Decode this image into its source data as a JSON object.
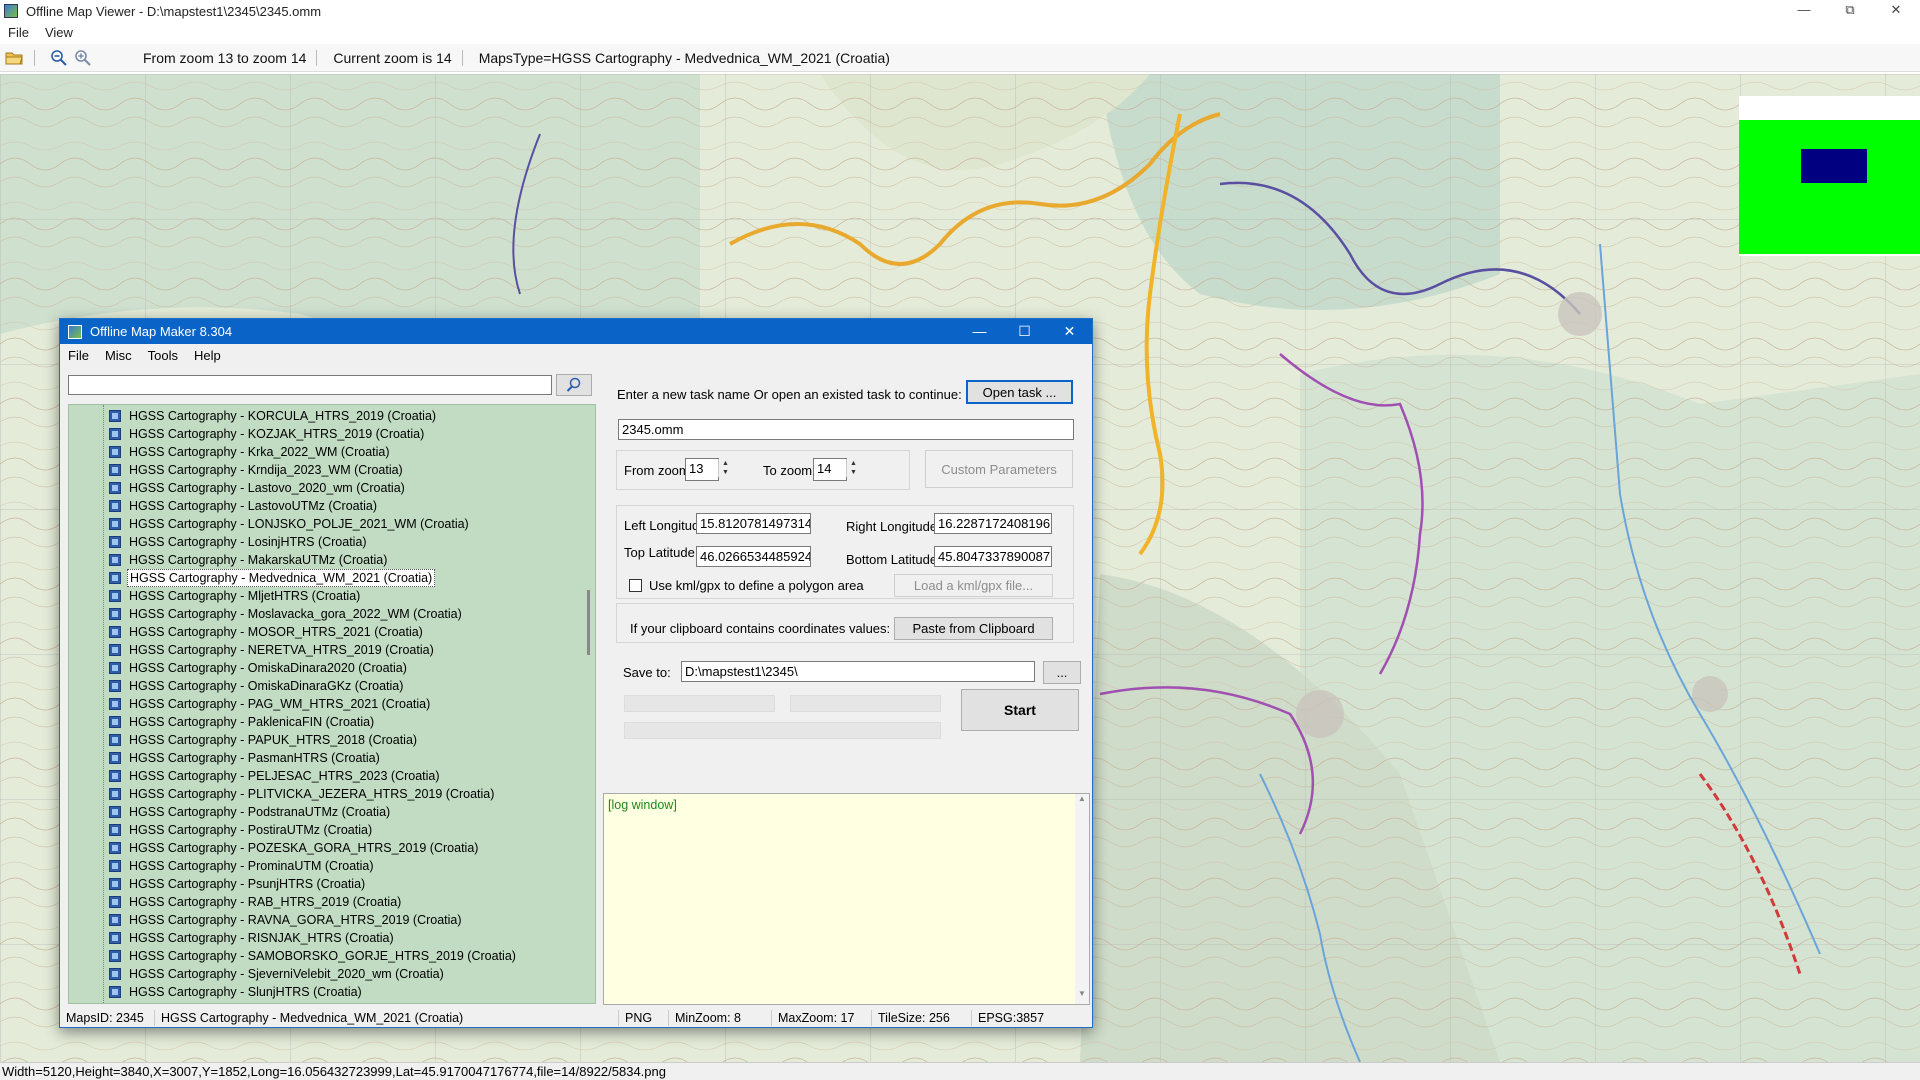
{
  "window": {
    "title": "Offline Map Viewer - D:\\mapstest1\\2345\\2345.omm",
    "menu": [
      "File",
      "View"
    ]
  },
  "toolbar": {
    "icons": [
      "open-folder-icon",
      "zoom-out-icon",
      "zoom-in-icon"
    ],
    "zoom_range": "From zoom 13 to zoom 14",
    "current_zoom": "Current zoom is 14",
    "maps_type": "MapsType=HGSS Cartography - Medvednica_WM_2021 (Croatia)"
  },
  "map": {
    "overview_colors": {
      "frame": "#00ff00",
      "viewport": "#000080"
    }
  },
  "statusbar": {
    "text": "Width=5120,Height=3840,X=3007,Y=1852,Long=16.056432723999,Lat=45.9170047176774,file=14/8922/5834.png"
  },
  "dialog": {
    "title": "Offline Map Maker 8.304",
    "menu": [
      "File",
      "Misc",
      "Tools",
      "Help"
    ],
    "search_value": "",
    "map_list": [
      "HGSS Cartography - KORCULA_HTRS_2019 (Croatia)",
      "HGSS Cartography - KOZJAK_HTRS_2019 (Croatia)",
      "HGSS Cartography - Krka_2022_WM (Croatia)",
      "HGSS Cartography - Krndija_2023_WM (Croatia)",
      "HGSS Cartography - Lastovo_2020_wm (Croatia)",
      "HGSS Cartography - LastovoUTMz (Croatia)",
      "HGSS Cartography - LONJSKO_POLJE_2021_WM (Croatia)",
      "HGSS Cartography - LosinjHTRS (Croatia)",
      "HGSS Cartography - MakarskaUTMz (Croatia)",
      "HGSS Cartography - Medvednica_WM_2021 (Croatia)",
      "HGSS Cartography - MljetHTRS (Croatia)",
      "HGSS Cartography - Moslavacka_gora_2022_WM (Croatia)",
      "HGSS Cartography - MOSOR_HTRS_2021 (Croatia)",
      "HGSS Cartography - NERETVA_HTRS_2019 (Croatia)",
      "HGSS Cartography - OmiskaDinara2020 (Croatia)",
      "HGSS Cartography - OmiskaDinaraGKz (Croatia)",
      "HGSS Cartography - PAG_WM_HTRS_2021 (Croatia)",
      "HGSS Cartography - PaklenicaFIN (Croatia)",
      "HGSS Cartography - PAPUK_HTRS_2018 (Croatia)",
      "HGSS Cartography - PasmanHTRS (Croatia)",
      "HGSS Cartography - PELJESAC_HTRS_2023 (Croatia)",
      "HGSS Cartography - PLITVICKA_JEZERA_HTRS_2019 (Croatia)",
      "HGSS Cartography - PodstranaUTMz (Croatia)",
      "HGSS Cartography - PostiraUTMz (Croatia)",
      "HGSS Cartography - POZESKA_GORA_HTRS_2019 (Croatia)",
      "HGSS Cartography - ProminaUTM (Croatia)",
      "HGSS Cartography - PsunjHTRS (Croatia)",
      "HGSS Cartography - RAB_HTRS_2019 (Croatia)",
      "HGSS Cartography - RAVNA_GORA_HTRS_2019 (Croatia)",
      "HGSS Cartography - RISNJAK_HTRS (Croatia)",
      "HGSS Cartography - SAMOBORSKO_GORJE_HTRS_2019 (Croatia)",
      "HGSS Cartography - SjeverniVelebit_2020_wm (Croatia)",
      "HGSS Cartography - SlunjHTRS (Croatia)"
    ],
    "selected_index": 9,
    "task_prompt": "Enter a new task name Or open an existed task to continue:",
    "open_task_label": "Open task ...",
    "task_name": "2345.omm",
    "from_zoom_label": "From zoom",
    "from_zoom_value": "13",
    "to_zoom_label": "To zoom",
    "to_zoom_value": "14",
    "custom_params_label": "Custom Parameters",
    "left_lon_label": "Left Longitude",
    "left_lon_value": "15.8120781497314",
    "right_lon_label": "Right Longitude",
    "right_lon_value": "16.2287172408196",
    "top_lat_label": "Top Latitude",
    "top_lat_value": "46.0266534485924",
    "bottom_lat_label": "Bottom Latitude",
    "bottom_lat_value": "45.8047337890087",
    "kml_checkbox_label": "Use kml/gpx to define a polygon area",
    "kml_checked": false,
    "load_kml_label": "Load a kml/gpx file...",
    "clipboard_prompt": "If your clipboard contains coordinates values:",
    "paste_label": "Paste from Clipboard",
    "save_to_label": "Save to:",
    "save_to_value": "D:\\mapstest1\\2345\\",
    "browse_label": "...",
    "start_label": "Start",
    "log_text": "[log window]",
    "status": {
      "maps_id": "MapsID: 2345",
      "map_name": "HGSS Cartography - Medvednica_WM_2021 (Croatia)",
      "format": "PNG",
      "min_zoom": "MinZoom: 8",
      "max_zoom": "MaxZoom: 17",
      "tile_size": "TileSize: 256",
      "epsg": "EPSG:3857"
    }
  }
}
